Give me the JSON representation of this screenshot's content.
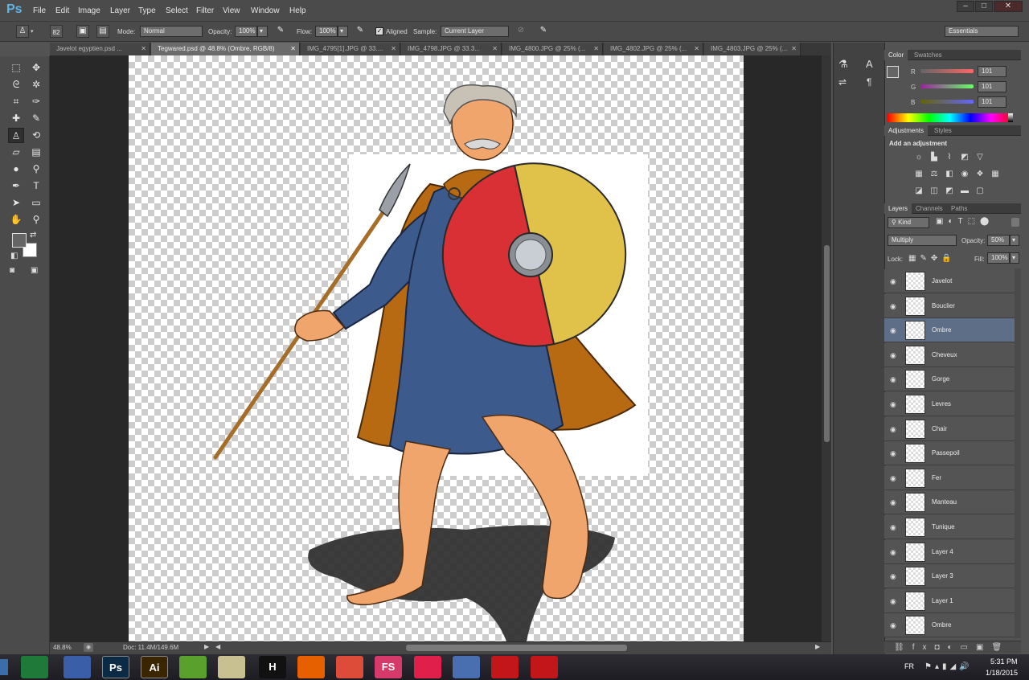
{
  "app": {
    "logo": "Ps"
  },
  "menu": [
    "File",
    "Edit",
    "Image",
    "Layer",
    "Type",
    "Select",
    "Filter",
    "View",
    "Window",
    "Help"
  ],
  "window_controls": [
    "–",
    "□",
    "✕"
  ],
  "options": {
    "brush_size": "82",
    "mode_label": "Mode:",
    "mode_value": "Normal",
    "opacity_label": "Opacity:",
    "opacity_value": "100%",
    "flow_label": "Flow:",
    "flow_value": "100%",
    "aligned_label": "Aligned",
    "aligned_checked": true,
    "sample_label": "Sample:",
    "sample_value": "Current Layer",
    "workspace": "Essentials"
  },
  "tabs": [
    {
      "label": "Javelot egyptien.psd ...",
      "active": false
    },
    {
      "label": "Tegwared.psd @ 48.8% (Ombre, RGB/8)",
      "active": true
    },
    {
      "label": "IMG_4795[1].JPG @ 33....",
      "active": false
    },
    {
      "label": "IMG_4798.JPG @ 33.3...",
      "active": false
    },
    {
      "label": "IMG_4800.JPG @ 25% (...",
      "active": false
    },
    {
      "label": "IMG_4802.JPG @ 25% (...",
      "active": false
    },
    {
      "label": "IMG_4803.JPG @ 25% (...",
      "active": false
    }
  ],
  "status": {
    "zoom": "48.8%",
    "doc": "Doc: 11.4M/149.6M"
  },
  "color_panel": {
    "tabs": [
      "Color",
      "Swatches"
    ],
    "r_label": "R",
    "g_label": "G",
    "b_label": "B",
    "r": "101",
    "g": "101",
    "b": "101"
  },
  "adjustments_panel": {
    "tabs": [
      "Adjustments",
      "Styles"
    ],
    "title": "Add an adjustment"
  },
  "layers_panel": {
    "tabs": [
      "Layers",
      "Channels",
      "Paths"
    ],
    "filter_kind": "Kind",
    "blend_mode": "Multiply",
    "opacity_label": "Opacity:",
    "opacity_value": "50%",
    "lock_label": "Lock:",
    "fill_label": "Fill:",
    "fill_value": "100%",
    "layers": [
      {
        "name": "Javelot",
        "selected": false
      },
      {
        "name": "Bouclier",
        "selected": false
      },
      {
        "name": "Ombre",
        "selected": true
      },
      {
        "name": "Cheveux",
        "selected": false
      },
      {
        "name": "Gorge",
        "selected": false
      },
      {
        "name": "Levres",
        "selected": false
      },
      {
        "name": "Chair",
        "selected": false
      },
      {
        "name": "Passepoil",
        "selected": false
      },
      {
        "name": "Fer",
        "selected": false
      },
      {
        "name": "Manteau",
        "selected": false
      },
      {
        "name": "Tunique",
        "selected": false
      },
      {
        "name": "Layer 4",
        "selected": false
      },
      {
        "name": "Layer 3",
        "selected": false
      },
      {
        "name": "Layer 1",
        "selected": false
      },
      {
        "name": "Ombre",
        "selected": false
      }
    ]
  },
  "taskbar": {
    "apps": [
      {
        "label": "",
        "color": "#1f7a3a",
        "name": "excel"
      },
      {
        "label": "",
        "color": "#3a5fa8",
        "name": "word"
      },
      {
        "label": "Ps",
        "color": "#0b2a45",
        "name": "photoshop"
      },
      {
        "label": "Ai",
        "color": "#3b2500",
        "name": "illustrator"
      },
      {
        "label": "",
        "color": "#5aa02c",
        "name": "app-green"
      },
      {
        "label": "",
        "color": "#c8c090",
        "name": "app-scanner"
      },
      {
        "label": "H",
        "color": "#111111",
        "name": "app-h"
      },
      {
        "label": "",
        "color": "#e66000",
        "name": "firefox"
      },
      {
        "label": "",
        "color": "#dd4b39",
        "name": "chrome"
      },
      {
        "label": "FS",
        "color": "#d63a6a",
        "name": "fs"
      },
      {
        "label": "",
        "color": "#e0204a",
        "name": "itunes"
      },
      {
        "label": "",
        "color": "#4a6fb0",
        "name": "app-globe"
      },
      {
        "label": "",
        "color": "#c2161b",
        "name": "acrobat"
      },
      {
        "label": "",
        "color": "#c2161b",
        "name": "filezilla"
      }
    ],
    "lang": "FR",
    "time": "5:31 PM",
    "date": "1/18/2015"
  }
}
